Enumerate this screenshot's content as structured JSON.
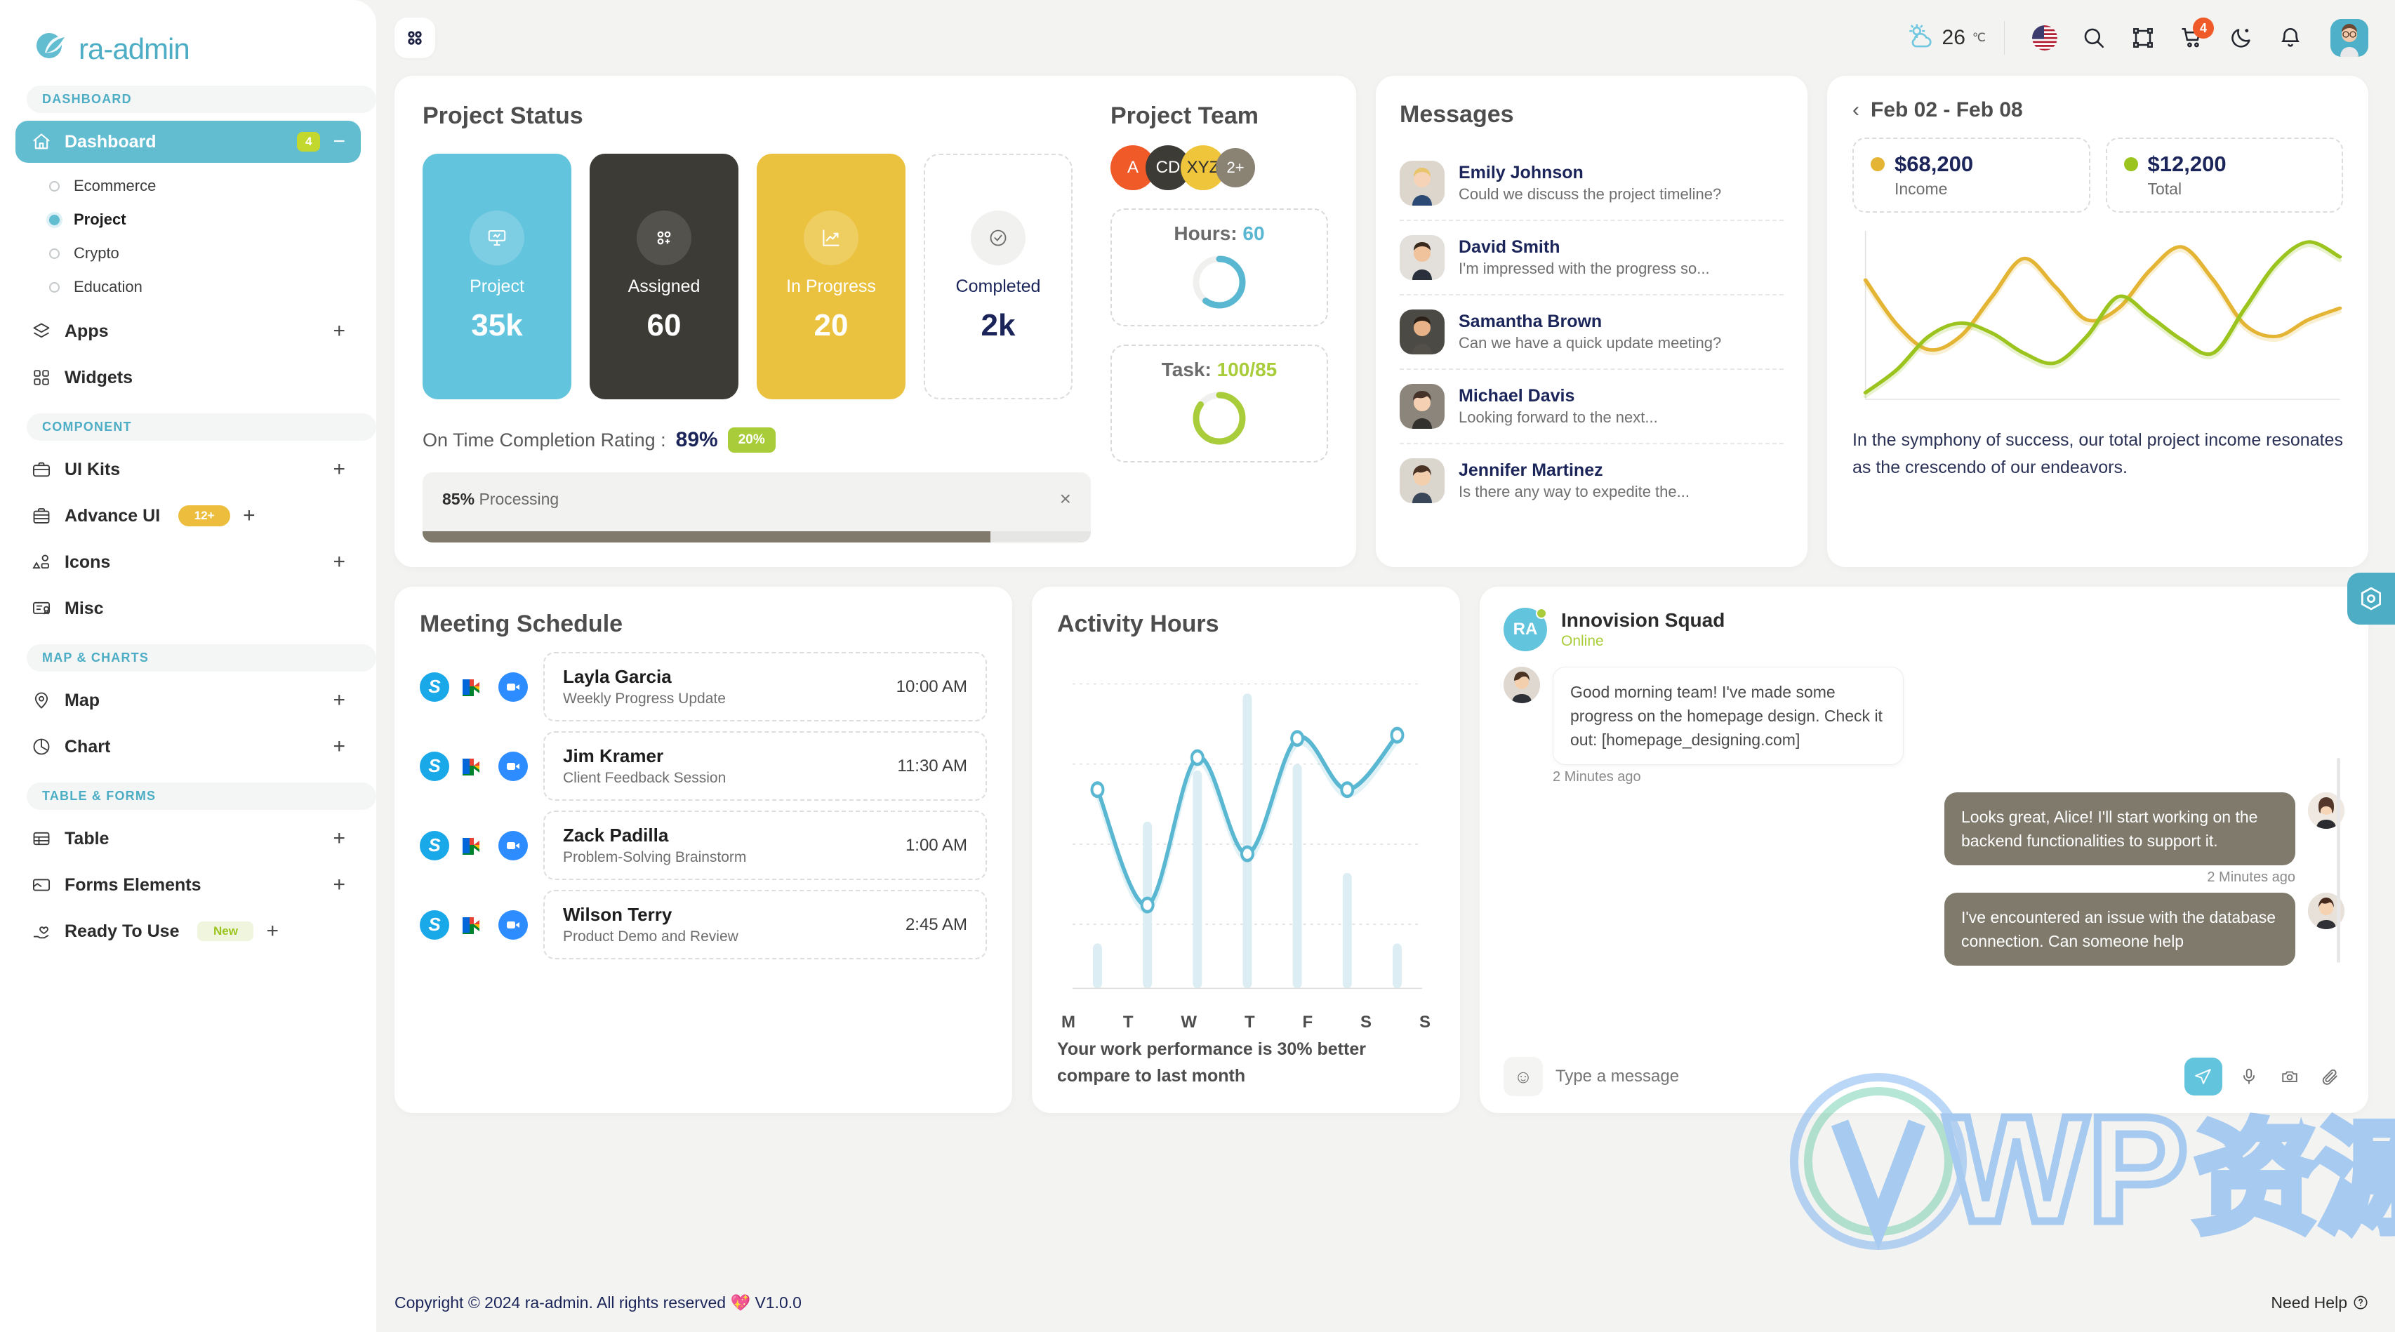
{
  "brand": {
    "name": "ra-admin"
  },
  "sidebar": {
    "sections": [
      {
        "label": "DASHBOARD"
      },
      {
        "label": "COMPONENT"
      },
      {
        "label": "MAP & CHARTS"
      },
      {
        "label": "TABLE & FORMS"
      }
    ],
    "dashboard": {
      "label": "Dashboard",
      "badge": "4",
      "collapse": "−"
    },
    "sub_items": [
      {
        "label": "Ecommerce",
        "active": false
      },
      {
        "label": "Project",
        "active": true
      },
      {
        "label": "Crypto",
        "active": false
      },
      {
        "label": "Education",
        "active": false
      }
    ],
    "items": [
      {
        "label": "Apps",
        "plus": "+",
        "badge": ""
      },
      {
        "label": "Widgets",
        "plus": "",
        "badge": ""
      },
      {
        "label": "UI Kits",
        "plus": "+",
        "badge": ""
      },
      {
        "label": "Advance UI",
        "plus": "+",
        "badge": "12+"
      },
      {
        "label": "Icons",
        "plus": "+",
        "badge": ""
      },
      {
        "label": "Misc",
        "plus": "",
        "badge": ""
      },
      {
        "label": "Map",
        "plus": "+",
        "badge": ""
      },
      {
        "label": "Chart",
        "plus": "+",
        "badge": ""
      },
      {
        "label": "Table",
        "plus": "+",
        "badge": ""
      },
      {
        "label": "Forms Elements",
        "plus": "+",
        "badge": ""
      },
      {
        "label": "Ready To Use",
        "plus": "+",
        "badge": "New"
      }
    ]
  },
  "topbar": {
    "temperature": "26",
    "temperature_unit": "℃",
    "cart_count": "4",
    "icons": [
      "weather-icon",
      "flag-icon",
      "search-icon",
      "fullscreen-icon",
      "cart-icon",
      "dark-mode-icon",
      "bell-icon",
      "avatar"
    ]
  },
  "project_status": {
    "title": "Project Status",
    "tiles": [
      {
        "label": "Project",
        "value": "35k",
        "icon": "presentation-icon",
        "style": "blue"
      },
      {
        "label": "Assigned",
        "value": "60",
        "icon": "assign-icon",
        "style": "dark"
      },
      {
        "label": "In Progress",
        "value": "20",
        "icon": "trending-up-icon",
        "style": "amber"
      },
      {
        "label": "Completed",
        "value": "2k",
        "icon": "check-circle-icon",
        "style": "plain"
      }
    ],
    "rating_label": "On Time Completion Rating :",
    "rating_value": "89%",
    "rating_badge": "20%",
    "progress_percent": "85%",
    "progress_label": "Processing",
    "progress_fill": 85,
    "close": "×"
  },
  "project_team": {
    "title": "Project Team",
    "avatars": [
      "A",
      "CD",
      "XYZ",
      "2+"
    ],
    "hours": {
      "label": "Hours:",
      "value": "60",
      "percent": 60
    },
    "task": {
      "label": "Task:",
      "value": "100/85",
      "percent": 85
    }
  },
  "messages": {
    "title": "Messages",
    "items": [
      {
        "name": "Emily Johnson",
        "preview": "Could we discuss the project timeline?"
      },
      {
        "name": "David Smith",
        "preview": "I'm impressed with the progress so..."
      },
      {
        "name": "Samantha Brown",
        "preview": "Can we have a quick update meeting?"
      },
      {
        "name": "Michael Davis",
        "preview": "Looking forward to the next..."
      },
      {
        "name": "Jennifer Martinez",
        "preview": "Is there any way to expedite the..."
      }
    ]
  },
  "income": {
    "range": "Feb 02 - Feb 08",
    "back_icon": "chevron-left-icon",
    "stats": [
      {
        "value": "$68,200",
        "label": "Income",
        "color": "#e4b434"
      },
      {
        "value": "$12,200",
        "label": "Total",
        "color": "#9cc41f"
      }
    ],
    "note": "In the symphony of success, our total project income resonates as the crescendo of our endeavors."
  },
  "meetings": {
    "title": "Meeting Schedule",
    "items": [
      {
        "name": "Layla Garcia",
        "topic": "Weekly Progress Update",
        "time": "10:00 AM"
      },
      {
        "name": "Jim Kramer",
        "topic": "Client Feedback Session",
        "time": "11:30 AM"
      },
      {
        "name": "Zack Padilla",
        "topic": "Problem-Solving Brainstorm",
        "time": "1:00 AM"
      },
      {
        "name": "Wilson Terry",
        "topic": "Product Demo and Review",
        "time": "2:45 AM"
      }
    ],
    "app_icons": [
      "skype-icon",
      "google-meet-icon",
      "zoom-icon"
    ]
  },
  "activity": {
    "title": "Activity Hours",
    "footnote": "Your work performance is 30% better compare to last month"
  },
  "chat": {
    "name": "Innovision Squad",
    "status": "Online",
    "avatar_initials": "RA",
    "messages": [
      {
        "side": "in",
        "text": "Good morning team! I've made some progress on the homepage design. Check it out: [homepage_designing.com]",
        "time": "2 Minutes ago"
      },
      {
        "side": "out",
        "text": "Looks great, Alice! I'll start working on the backend functionalities to support it.",
        "time": "2 Minutes ago"
      },
      {
        "side": "out",
        "text": "I've encountered an issue with the database connection. Can someone help",
        "time": ""
      }
    ],
    "input_placeholder": "Type a message",
    "tools": [
      "emoji-icon",
      "send-icon",
      "microphone-icon",
      "camera-icon",
      "attachment-icon"
    ]
  },
  "footer": {
    "copyright": "Copyright © 2024 ra-admin. All rights reserved 💖 V1.0.0",
    "need_help": "Need Help"
  },
  "chart_data": [
    {
      "type": "line",
      "title": "Feb 02 - Feb 08",
      "series": [
        {
          "name": "Income",
          "color": "#e4b434",
          "values": [
            72,
            45,
            30,
            38,
            62,
            85,
            68,
            48,
            55,
            78,
            92,
            72,
            45,
            38,
            48,
            55
          ]
        },
        {
          "name": "Total",
          "color": "#9cc41f",
          "values": [
            4,
            18,
            38,
            46,
            40,
            28,
            22,
            38,
            62,
            50,
            36,
            28,
            55,
            82,
            95,
            86
          ]
        }
      ],
      "x": [
        0,
        1,
        2,
        3,
        4,
        5,
        6,
        7,
        8,
        9,
        10,
        11,
        12,
        13,
        14,
        15
      ],
      "xlabel": "",
      "ylabel": "",
      "grid": false,
      "legend_position": "top"
    },
    {
      "type": "line",
      "title": "Activity Hours",
      "categories": [
        "M",
        "T",
        "W",
        "T",
        "F",
        "S",
        "S"
      ],
      "series": [
        {
          "name": "Hours",
          "color": "#5ab7d2",
          "values": [
            62,
            26,
            72,
            42,
            78,
            62,
            79
          ]
        }
      ],
      "bars": {
        "name": "Background bars",
        "color": "#dceef4",
        "values": [
          14,
          52,
          68,
          92,
          70,
          36,
          14
        ]
      },
      "ylim": [
        0,
        100
      ],
      "xlabel": "",
      "ylabel": "",
      "grid": true,
      "legend_position": "none"
    }
  ]
}
